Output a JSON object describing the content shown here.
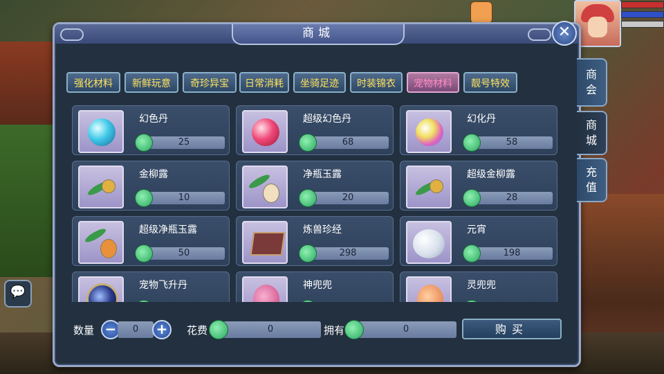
{
  "panel": {
    "title": "商城"
  },
  "categories": [
    {
      "label": "强化材料",
      "active": false
    },
    {
      "label": "新鲜玩意",
      "active": false
    },
    {
      "label": "奇珍异宝",
      "active": false
    },
    {
      "label": "日常消耗",
      "active": false
    },
    {
      "label": "坐骑足迹",
      "active": false
    },
    {
      "label": "时装锦衣",
      "active": false
    },
    {
      "label": "宠物材料",
      "active": true
    },
    {
      "label": "靓号特效",
      "active": false
    }
  ],
  "items": [
    {
      "name": "幻色丹",
      "price": "25",
      "icon": "blue-orb-icon"
    },
    {
      "name": "超级幻色丹",
      "price": "68",
      "icon": "red-orb-icon"
    },
    {
      "name": "幻化丹",
      "price": "58",
      "icon": "rainbow-orb-icon"
    },
    {
      "name": "金柳露",
      "price": "10",
      "icon": "willow-dew-icon"
    },
    {
      "name": "净瓶玉露",
      "price": "20",
      "icon": "vase-dew-icon"
    },
    {
      "name": "超级金柳露",
      "price": "28",
      "icon": "willow-dew-icon"
    },
    {
      "name": "超级净瓶玉露",
      "price": "50",
      "icon": "gourd-dew-icon"
    },
    {
      "name": "炼兽珍经",
      "price": "298",
      "icon": "book-icon"
    },
    {
      "name": "元宵",
      "price": "198",
      "icon": "rice-ball-icon"
    },
    {
      "name": "宠物飞升丹",
      "price": "",
      "icon": "dark-orb-icon"
    },
    {
      "name": "神兜兜",
      "price": "",
      "icon": "pouch-icon"
    },
    {
      "name": "灵兜兜",
      "price": "",
      "icon": "pouch-icon"
    }
  ],
  "purchase": {
    "quantity_label": "数量",
    "quantity_value": "0",
    "minus": "−",
    "plus": "+",
    "cost_label": "花费",
    "cost_value": "0",
    "owned_label": "拥有",
    "owned_value": "0",
    "buy_label": "购买"
  },
  "side_tabs": [
    {
      "label": "商会",
      "active": false
    },
    {
      "label": "商城",
      "active": true
    },
    {
      "label": "充值",
      "active": false
    }
  ],
  "close": "✕",
  "chat": "💬",
  "colors": {
    "tab_text": "#ffe25a",
    "active_tab_text": "#ff8ac8",
    "panel_bg": "#223040"
  }
}
